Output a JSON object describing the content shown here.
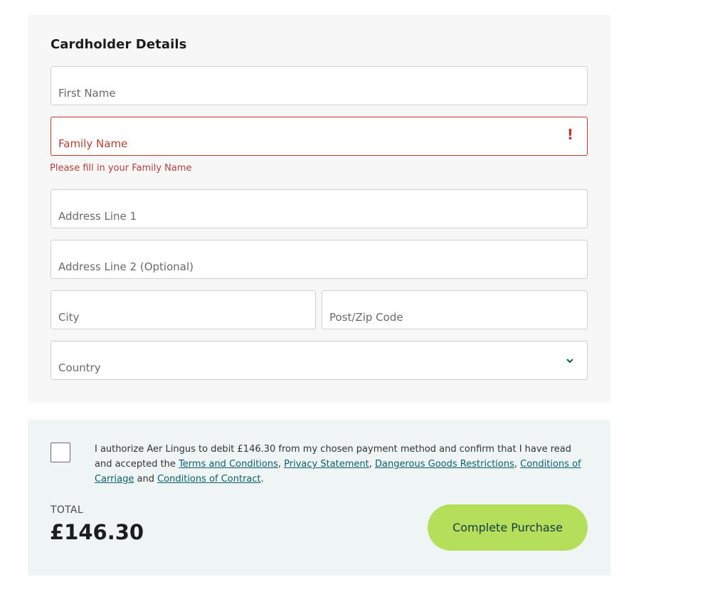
{
  "cardholder": {
    "title": "Cardholder Details",
    "first_name_placeholder": "First Name",
    "family_name_placeholder": "Family Name",
    "family_name_error": "Please fill in your Family Name",
    "error_icon": "!",
    "address1_placeholder": "Address Line 1",
    "address2_placeholder": "Address Line 2 (Optional)",
    "city_placeholder": "City",
    "postcode_placeholder": "Post/Zip Code",
    "country_placeholder": "Country"
  },
  "consent": {
    "checked": false,
    "text_prefix": "I authorize Aer Lingus to debit £146.30 from my chosen payment method and confirm that I have read and accepted the ",
    "link_terms": "Terms and Conditions",
    "link_privacy": "Privacy Statement",
    "link_dangerous": "Dangerous Goods Restrictions",
    "link_carriage": "Conditions of Carriage",
    "and_text": "and",
    "link_contract": "Conditions of Contract"
  },
  "summary": {
    "total_label": "TOTAL",
    "total_amount": "£146.30",
    "cta_label": "Complete Purchase"
  },
  "colors": {
    "error": "#c0392b",
    "link": "#0b5f6e",
    "cta_bg": "#b5df5a"
  },
  "icons": [
    "error-exclamation-icon",
    "chevron-down-icon"
  ]
}
